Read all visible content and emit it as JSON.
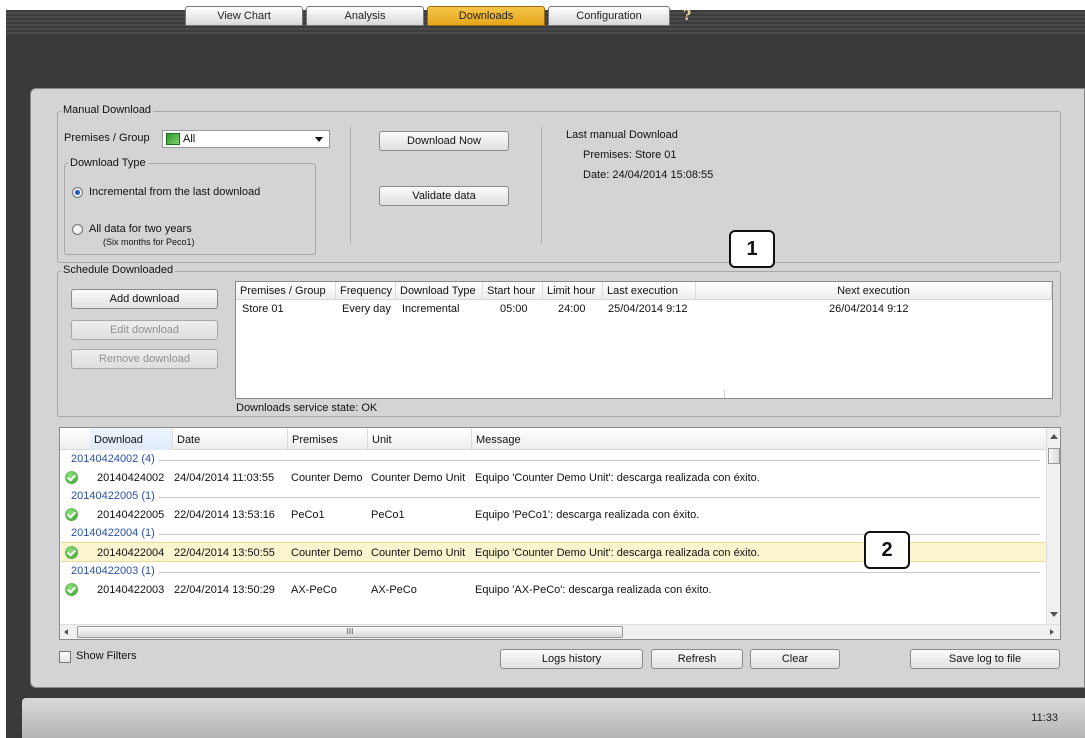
{
  "nav": {
    "tabs": [
      {
        "label": "View Chart",
        "active": false
      },
      {
        "label": "Analysis",
        "active": false
      },
      {
        "label": "Downloads",
        "active": true
      },
      {
        "label": "Configuration",
        "active": false
      }
    ],
    "help_label": "?",
    "active_color": "#f0b830"
  },
  "manual_download": {
    "title": "Manual Download",
    "premises_label": "Premises / Group",
    "premises_value": "All",
    "download_type_title": "Download Type",
    "option_incremental": "Incremental from the last download",
    "option_all": "All data for two years",
    "option_all_note": "(Six months for Peco1)",
    "selected_option": "incremental",
    "download_now_label": "Download Now",
    "validate_label": "Validate data",
    "last_title": "Last manual Download",
    "last_premises": "Premises: Store 01",
    "last_date": "Date: 24/04/2014 15:08:55"
  },
  "schedule": {
    "title": "Schedule Downloaded",
    "add_label": "Add download",
    "edit_label": "Edit download",
    "remove_label": "Remove download",
    "columns": [
      "Premises / Group",
      "Frequency",
      "Download Type",
      "Start hour",
      "Limit hour",
      "Last execution",
      "Next execution"
    ],
    "rows": [
      [
        "Store 01",
        "Every day",
        "Incremental",
        "05:00",
        "24:00",
        "25/04/2014 9:12",
        "26/04/2014 9:12"
      ]
    ],
    "service_state": "Downloads service state: OK"
  },
  "callouts": {
    "one": "1",
    "two": "2"
  },
  "log": {
    "columns": [
      "Download",
      "Date",
      "Premises",
      "Unit",
      "Message"
    ],
    "groups": [
      {
        "label": "20140424002 (4)",
        "row": [
          "20140424002",
          "24/04/2014 11:03:55",
          "Counter Demo",
          "Counter Demo Unit",
          "Equipo 'Counter Demo Unit': descarga realizada con éxito."
        ],
        "selected": false
      },
      {
        "label": "20140422005 (1)",
        "row": [
          "20140422005",
          "22/04/2014 13:53:16",
          "PeCo1",
          "PeCo1",
          "Equipo 'PeCo1': descarga realizada con éxito."
        ],
        "selected": false
      },
      {
        "label": "20140422004 (1)",
        "row": [
          "20140422004",
          "22/04/2014 13:50:55",
          "Counter Demo",
          "Counter Demo Unit",
          "Equipo 'Counter Demo Unit': descarga realizada con éxito."
        ],
        "selected": true
      },
      {
        "label": "20140422003 (1)",
        "row": [
          "20140422003",
          "22/04/2014 13:50:29",
          "AX-PeCo",
          "AX-PeCo",
          "Equipo 'AX-PeCo': descarga realizada con éxito."
        ],
        "selected": false
      }
    ],
    "scroll_grip": "III"
  },
  "bottom": {
    "show_filters_label": "Show Filters",
    "logs_history_label": "Logs history",
    "refresh_label": "Refresh",
    "clear_label": "Clear",
    "save_log_label": "Save log to file"
  },
  "status": {
    "clock": "11:33"
  }
}
